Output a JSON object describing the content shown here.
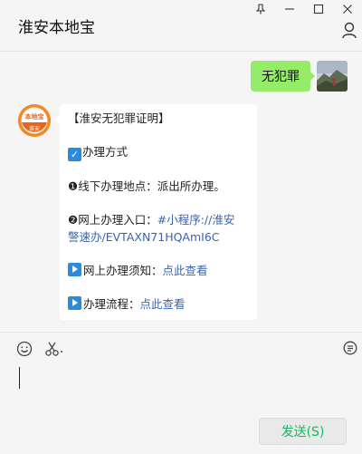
{
  "window": {
    "pin_icon": "pin-icon",
    "minimize_icon": "minimize-icon",
    "maximize_icon": "maximize-icon",
    "close_icon": "close-icon"
  },
  "header": {
    "title": "淮安本地宝",
    "profile_icon": "person-icon"
  },
  "messages": {
    "sent": {
      "text": "无犯罪"
    },
    "received": {
      "avatar_logo_top": "本地宝",
      "avatar_logo_bottom": "淮安",
      "heading": "【淮安无犯罪证明】",
      "section_title": "办理方式",
      "offline_bullet": "❶",
      "offline_text": "线下办理地点：派出所办理。",
      "online_bullet": "❷",
      "online_label": "网上办理入口：",
      "online_link_1": "#小程序://淮安",
      "online_link_2": "警速办/EVTAXN71HQAmI6C",
      "notice_label": "网上办理须知：",
      "notice_link": "点此查看",
      "process_label": "办理流程：",
      "process_link": "点此查看"
    }
  },
  "composer": {
    "emoji_icon": "emoji-icon",
    "scissors_icon": "scissors-icon",
    "history_icon": "chat-history-icon",
    "send_label": "发送(S)"
  },
  "colors": {
    "sent_bubble": "#95ec69",
    "link": "#3a64b0",
    "send_text": "#07c160",
    "icon_blue": "#2a8be0"
  }
}
